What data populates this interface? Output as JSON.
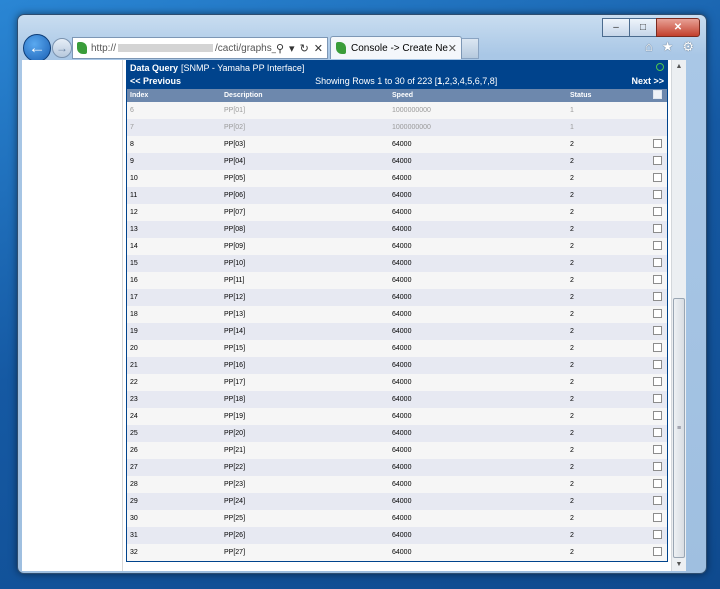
{
  "browser": {
    "address_url_prefix": "http://",
    "address_url_suffix": "/cacti/graphs_new.ph",
    "tab_title": "Console -> Create New ..."
  },
  "dq": {
    "title_bold": "Data Query",
    "title_rest": "[SNMP - Yamaha PP Interface]",
    "prev": "<< Previous",
    "showing": "Showing Rows 1 to 30 of 223 [",
    "current_page": "1",
    "other_pages": ",2,3,4,5,6,7,8]",
    "next": "Next >>"
  },
  "columns": [
    "Index",
    "Description",
    "Speed",
    "Status"
  ],
  "rows": [
    {
      "index": "6",
      "desc": "PP[01]",
      "speed": "1000000000",
      "status": "1",
      "dim": true
    },
    {
      "index": "7",
      "desc": "PP[02]",
      "speed": "1000000000",
      "status": "1",
      "dim": true
    },
    {
      "index": "8",
      "desc": "PP[03]",
      "speed": "64000",
      "status": "2"
    },
    {
      "index": "9",
      "desc": "PP[04]",
      "speed": "64000",
      "status": "2"
    },
    {
      "index": "10",
      "desc": "PP[05]",
      "speed": "64000",
      "status": "2"
    },
    {
      "index": "11",
      "desc": "PP[06]",
      "speed": "64000",
      "status": "2"
    },
    {
      "index": "12",
      "desc": "PP[07]",
      "speed": "64000",
      "status": "2"
    },
    {
      "index": "13",
      "desc": "PP[08]",
      "speed": "64000",
      "status": "2"
    },
    {
      "index": "14",
      "desc": "PP[09]",
      "speed": "64000",
      "status": "2"
    },
    {
      "index": "15",
      "desc": "PP[10]",
      "speed": "64000",
      "status": "2"
    },
    {
      "index": "16",
      "desc": "PP[11]",
      "speed": "64000",
      "status": "2"
    },
    {
      "index": "17",
      "desc": "PP[12]",
      "speed": "64000",
      "status": "2"
    },
    {
      "index": "18",
      "desc": "PP[13]",
      "speed": "64000",
      "status": "2"
    },
    {
      "index": "19",
      "desc": "PP[14]",
      "speed": "64000",
      "status": "2"
    },
    {
      "index": "20",
      "desc": "PP[15]",
      "speed": "64000",
      "status": "2"
    },
    {
      "index": "21",
      "desc": "PP[16]",
      "speed": "64000",
      "status": "2"
    },
    {
      "index": "22",
      "desc": "PP[17]",
      "speed": "64000",
      "status": "2"
    },
    {
      "index": "23",
      "desc": "PP[18]",
      "speed": "64000",
      "status": "2"
    },
    {
      "index": "24",
      "desc": "PP[19]",
      "speed": "64000",
      "status": "2"
    },
    {
      "index": "25",
      "desc": "PP[20]",
      "speed": "64000",
      "status": "2"
    },
    {
      "index": "26",
      "desc": "PP[21]",
      "speed": "64000",
      "status": "2"
    },
    {
      "index": "27",
      "desc": "PP[22]",
      "speed": "64000",
      "status": "2"
    },
    {
      "index": "28",
      "desc": "PP[23]",
      "speed": "64000",
      "status": "2"
    },
    {
      "index": "29",
      "desc": "PP[24]",
      "speed": "64000",
      "status": "2"
    },
    {
      "index": "30",
      "desc": "PP[25]",
      "speed": "64000",
      "status": "2"
    },
    {
      "index": "31",
      "desc": "PP[26]",
      "speed": "64000",
      "status": "2"
    },
    {
      "index": "32",
      "desc": "PP[27]",
      "speed": "64000",
      "status": "2"
    }
  ],
  "colors": {
    "header_bg": "#00438c",
    "column_header_bg": "#6d88ad",
    "row_odd": "#f6f6f6",
    "row_even": "#e7e9f2"
  }
}
